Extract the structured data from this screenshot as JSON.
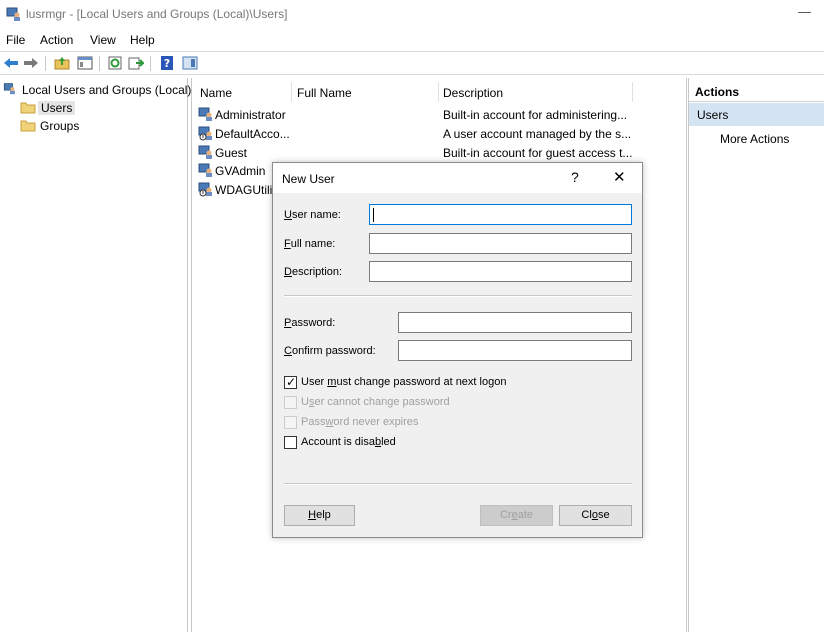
{
  "window": {
    "title": "lusrmgr - [Local Users and Groups (Local)\\Users]",
    "minimize_glyph": "—"
  },
  "menu": [
    "File",
    "Action",
    "View",
    "Help"
  ],
  "toolbar": {
    "icons": [
      "back-icon",
      "forward-icon",
      "up-folder-icon",
      "show-hide-tree-icon",
      "refresh-icon",
      "export-list-icon",
      "help-icon",
      "action-pane-icon"
    ]
  },
  "tree": {
    "root": "Local Users and Groups (Local)",
    "children": [
      "Users",
      "Groups"
    ],
    "selected": "Users"
  },
  "list": {
    "columns": [
      "Name",
      "Full Name",
      "Description"
    ],
    "rows": [
      {
        "name": "Administrator",
        "full_name": "",
        "description": "Built-in account for administering..."
      },
      {
        "name": "DefaultAcco...",
        "full_name": "",
        "description": "A user account managed by the s..."
      },
      {
        "name": "Guest",
        "full_name": "",
        "description": "Built-in account for guest access t..."
      },
      {
        "name": "GVAdmin",
        "full_name": "",
        "description": ""
      },
      {
        "name": "WDAGUtilit",
        "full_name": "",
        "description": ""
      }
    ]
  },
  "actions": {
    "header": "Actions",
    "section": "Users",
    "items": [
      "More Actions"
    ],
    "colors": {
      "section_bg": "#d5e4f3"
    }
  },
  "dialog": {
    "title": "New User",
    "help_glyph": "?",
    "close_glyph": "✕",
    "fields": {
      "user_name": {
        "label_pre": "",
        "label_u": "U",
        "label_post": "ser name:",
        "value": ""
      },
      "full_name": {
        "label_pre": "",
        "label_u": "F",
        "label_post": "ull name:",
        "value": ""
      },
      "description": {
        "label_pre": "",
        "label_u": "D",
        "label_post": "escription:",
        "value": ""
      },
      "password": {
        "label_pre": "",
        "label_u": "P",
        "label_post": "assword:",
        "value": ""
      },
      "confirm_password": {
        "label_pre": "",
        "label_u": "C",
        "label_post": "onfirm password:",
        "value": ""
      }
    },
    "checkboxes": [
      {
        "pre": "User ",
        "u": "m",
        "post": "ust change password at next logon",
        "checked": true,
        "disabled": false
      },
      {
        "pre": "U",
        "u": "s",
        "post": "er cannot change password",
        "checked": false,
        "disabled": true
      },
      {
        "pre": "Pass",
        "u": "w",
        "post": "ord never expires",
        "checked": false,
        "disabled": true
      },
      {
        "pre": "Account is disa",
        "u": "b",
        "post": "led",
        "checked": false,
        "disabled": false
      }
    ],
    "buttons": {
      "help": {
        "u": "H",
        "post": "elp"
      },
      "create": {
        "pre": "Cr",
        "u": "e",
        "post": "ate",
        "disabled": true
      },
      "close": {
        "pre": "Cl",
        "u": "o",
        "post": "se"
      }
    },
    "colors": {
      "focus_border": "#0078d7",
      "dialog_bg": "#f0f0f0"
    }
  }
}
